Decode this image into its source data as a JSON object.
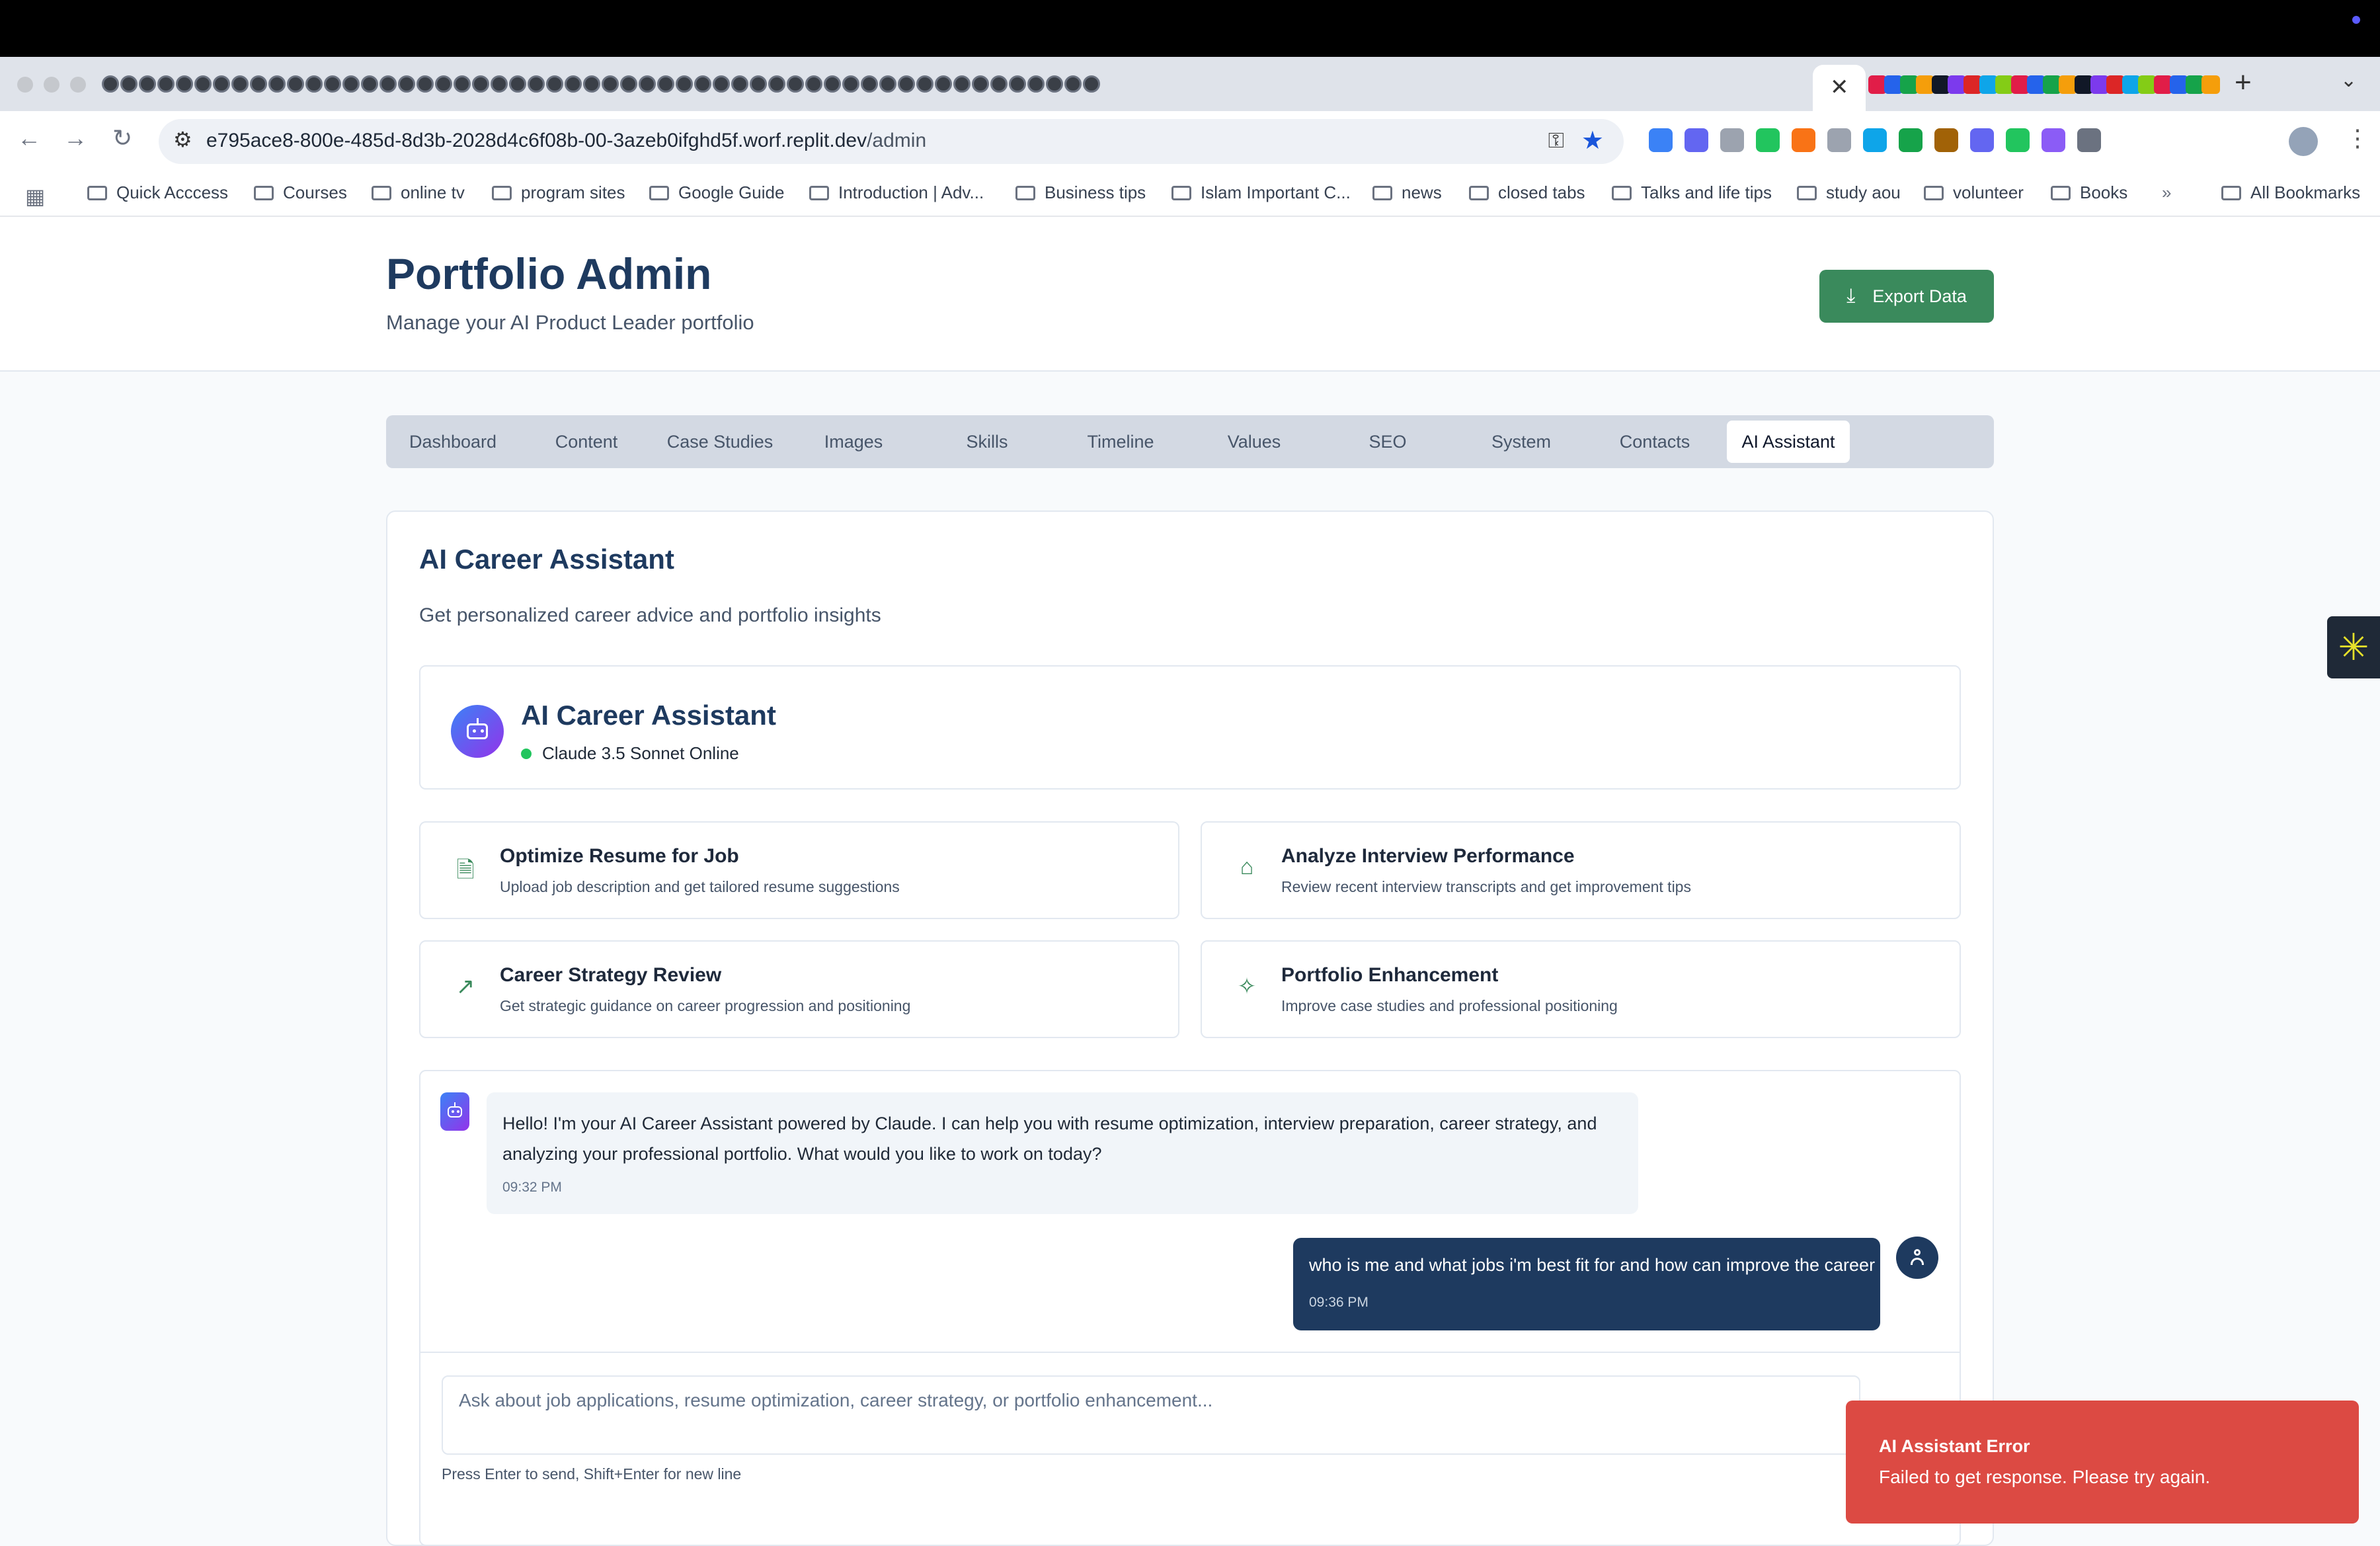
{
  "browser": {
    "url_host": "e795ace8-800e-485d-8d3b-2028d4c6f08b-00-3azeb0ifghd5f.worf.replit.dev",
    "url_path": "/admin",
    "bookmarks": [
      "Quick Acccess",
      "Courses",
      "online tv",
      "program sites",
      "Google Guide",
      "Introduction | Adv...",
      "Business tips",
      "Islam Important C...",
      "news",
      "closed tabs",
      "Talks and life tips",
      "study aou",
      "volunteer",
      "Books"
    ],
    "all_bookmarks_label": "All Bookmarks"
  },
  "header": {
    "title": "Portfolio Admin",
    "subtitle": "Manage your AI Product Leader portfolio",
    "export_label": "Export Data"
  },
  "tabs": [
    {
      "label": "Dashboard"
    },
    {
      "label": "Content"
    },
    {
      "label": "Case Studies"
    },
    {
      "label": "Images"
    },
    {
      "label": "Skills"
    },
    {
      "label": "Timeline"
    },
    {
      "label": "Values"
    },
    {
      "label": "SEO"
    },
    {
      "label": "System"
    },
    {
      "label": "Contacts"
    },
    {
      "label": "AI Assistant"
    }
  ],
  "active_tab": "AI Assistant",
  "section": {
    "title": "AI Career Assistant",
    "subtitle": "Get personalized career advice and portfolio insights"
  },
  "assistant": {
    "name": "AI Career Assistant",
    "status": "Claude 3.5 Sonnet Online",
    "status_color": "#22c55e"
  },
  "quick_actions": [
    {
      "icon": "document-icon",
      "title": "Optimize Resume for Job",
      "desc": "Upload job description and get tailored resume suggestions"
    },
    {
      "icon": "briefcase-icon",
      "title": "Analyze Interview Performance",
      "desc": "Review recent interview transcripts and get improvement tips"
    },
    {
      "icon": "trending-up-icon",
      "title": "Career Strategy Review",
      "desc": "Get strategic guidance on career progression and positioning"
    },
    {
      "icon": "sparkles-icon",
      "title": "Portfolio Enhancement",
      "desc": "Improve case studies and professional positioning"
    }
  ],
  "chat": {
    "messages": [
      {
        "role": "assistant",
        "text": "Hello! I'm your AI Career Assistant powered by Claude. I can help you with resume optimization, interview preparation, career strategy, and analyzing your professional portfolio. What would you like to work on today?",
        "time": "09:32 PM"
      },
      {
        "role": "user",
        "text": "who is me and what jobs i'm best fit for and how can improve the career",
        "time": "09:36 PM"
      }
    ],
    "input_placeholder": "Ask about job applications, resume optimization, career strategy, or portfolio enhancement...",
    "hint": "Press Enter to send, Shift+Enter for new line"
  },
  "toast": {
    "title": "AI Assistant Error",
    "message": "Failed to get response. Please try again.",
    "color": "#dc4a43"
  },
  "colors": {
    "brand_navy": "#1e3a5f",
    "accent_green": "#3a8a5c"
  }
}
